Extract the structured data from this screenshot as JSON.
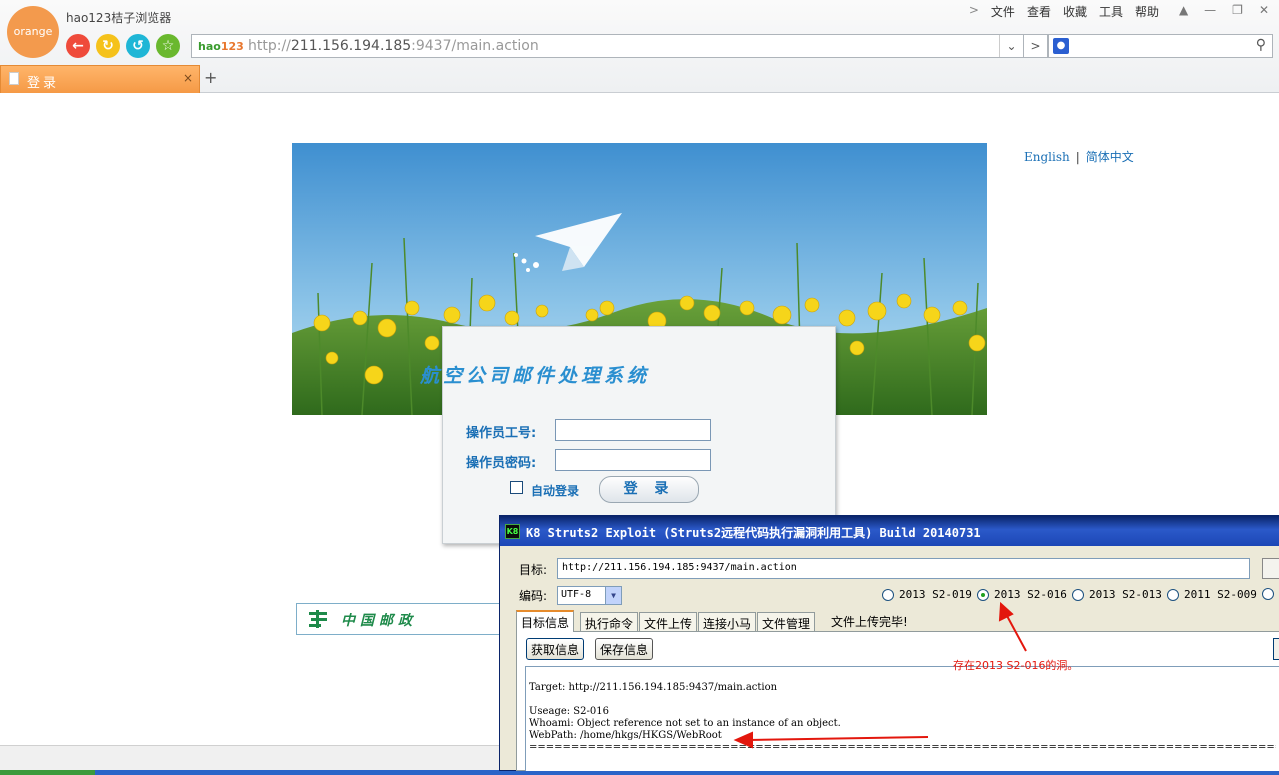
{
  "browser": {
    "logo_text": "orange",
    "app_title": "hao123桔子浏览器",
    "menu": [
      "文件",
      "查看",
      "收藏",
      "工具",
      "帮助"
    ],
    "address": {
      "brand_a": "hao",
      "brand_b": "123",
      "url_prefix": "http://",
      "url_host": "211.156.194.185",
      "url_suffix": ":9437/main.action"
    },
    "tab_title": "登录",
    "new_tab": "+",
    "tab_close": "×"
  },
  "page": {
    "lang_en": "English",
    "lang_zh": "简体中文",
    "lang_sep": "|",
    "system_title": "航空公司邮件处理系统",
    "label_id": "操作员工号:",
    "label_pwd": "操作员密码:",
    "auto_login": "自动登录",
    "login_button": "登 录",
    "post_logo": "中国邮政"
  },
  "k8": {
    "caption": "K8 Struts2 Exploit (Struts2远程代码执行漏洞利用工具) Build 20140731",
    "icon": "K8",
    "target_label": "目标:",
    "target_value": "http://211.156.194.185:9437/main.action",
    "encoding_label": "编码:",
    "encoding_value": "UTF-8",
    "radios": [
      {
        "label": "2013 S2-019",
        "checked": false
      },
      {
        "label": "2013 S2-016",
        "checked": true
      },
      {
        "label": "2013 S2-013",
        "checked": false
      },
      {
        "label": "2011 S2-009",
        "checked": false
      }
    ],
    "tabs": [
      "目标信息",
      "执行命令",
      "文件上传",
      "连接小马",
      "文件管理"
    ],
    "upload_complete": "文件上传完毕!",
    "btn_get_info": "获取信息",
    "btn_save_info": "保存信息",
    "output": {
      "target": "Target: http://211.156.194.185:9437/main.action",
      "useage": "Useage: S2-016",
      "whoami": "Whoami: Object reference not set to an instance of an object.",
      "webpath": "WebPath: /home/hkgs/HKGS/WebRoot",
      "rule": "================================================================================================================================================="
    },
    "annotation": "存在2013 S2-016的洞。"
  },
  "colors": {
    "tab_orange": "#f59a46",
    "link_blue": "#1a6fb5",
    "title_blue": "#2b59c9",
    "annotation_red": "#e3170d"
  }
}
